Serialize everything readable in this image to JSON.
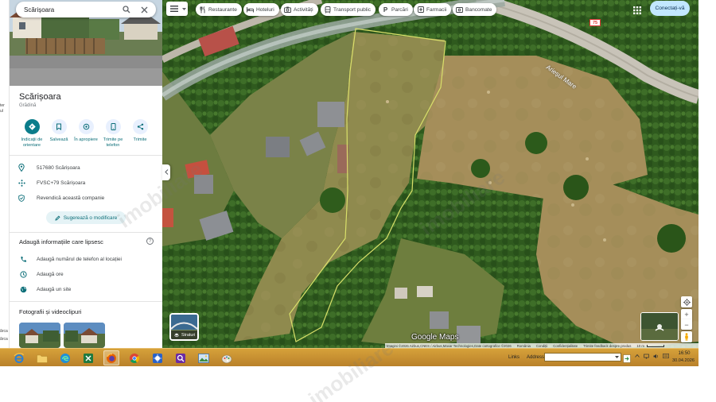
{
  "search": {
    "query": "Scărișoara"
  },
  "place": {
    "title": "Scărișoara",
    "category": "Grădină",
    "actions": [
      {
        "label": "Indicații de orientare",
        "icon": "directions-icon"
      },
      {
        "label": "Salvează",
        "icon": "bookmark-icon"
      },
      {
        "label": "În apropiere",
        "icon": "nearby-icon"
      },
      {
        "label": "Trimite pe telefon",
        "icon": "phone-icon"
      },
      {
        "label": "Trimite",
        "icon": "share-icon"
      }
    ],
    "info": [
      {
        "text": "517680 Scărișoara",
        "icon": "location-pin-icon"
      },
      {
        "text": "FVSC+79 Scărișoara",
        "icon": "plus-code-icon"
      },
      {
        "text": "Revendică această companie",
        "icon": "verified-shield-icon"
      }
    ],
    "suggest_label": "Sugerează o modificare"
  },
  "missing": {
    "heading": "Adaugă informațiile care lipsesc",
    "help_glyph": "?",
    "items": [
      {
        "text": "Adaugă numărul de telefon al locației",
        "icon": "phone-add-icon"
      },
      {
        "text": "Adaugă ore",
        "icon": "clock-icon"
      },
      {
        "text": "Adaugă un site",
        "icon": "globe-icon"
      }
    ]
  },
  "photos": {
    "heading": "Fotografii și videoclipuri"
  },
  "left_strip": {
    "fragments": [
      "ter",
      "ul",
      "ărca",
      "ărca"
    ]
  },
  "map": {
    "chips": [
      {
        "label": "Restaurante",
        "icon": "restaurant-icon"
      },
      {
        "label": "Hoteluri",
        "icon": "hotel-icon"
      },
      {
        "label": "Activități",
        "icon": "camera-icon"
      },
      {
        "label": "Transport public",
        "icon": "transit-icon"
      },
      {
        "label": "Parcări",
        "icon": "parking-icon"
      },
      {
        "label": "Farmacii",
        "icon": "pharmacy-icon"
      },
      {
        "label": "Bancomate",
        "icon": "atm-icon"
      }
    ],
    "sign_in": "Conectați-vă",
    "layers_label": "Straturi",
    "logo": "Google Maps",
    "road_label": "Arieșul Mare",
    "route_shield": "75",
    "attribution": [
      "Imagini ©2026 Airbus,CNES / Airbus,Maxar Technologies,Date cartografice ©2026",
      "România",
      "Condiții",
      "Confidențialitate",
      "Trimite feedback despre produs",
      "10 m"
    ],
    "controls": {
      "zoom_in": "+",
      "zoom_out": "−"
    }
  },
  "taskbar": {
    "apps": [
      "ie-icon",
      "folder-icon",
      "edge-icon",
      "excel-icon",
      "firefox-icon",
      "chrome-icon",
      "app-icon",
      "search-app-icon",
      "picture-icon",
      "paint-icon"
    ],
    "links": "Links",
    "address": "Address",
    "time": "16:50",
    "date": "30.04.2026"
  },
  "watermark": "imobiliare"
}
